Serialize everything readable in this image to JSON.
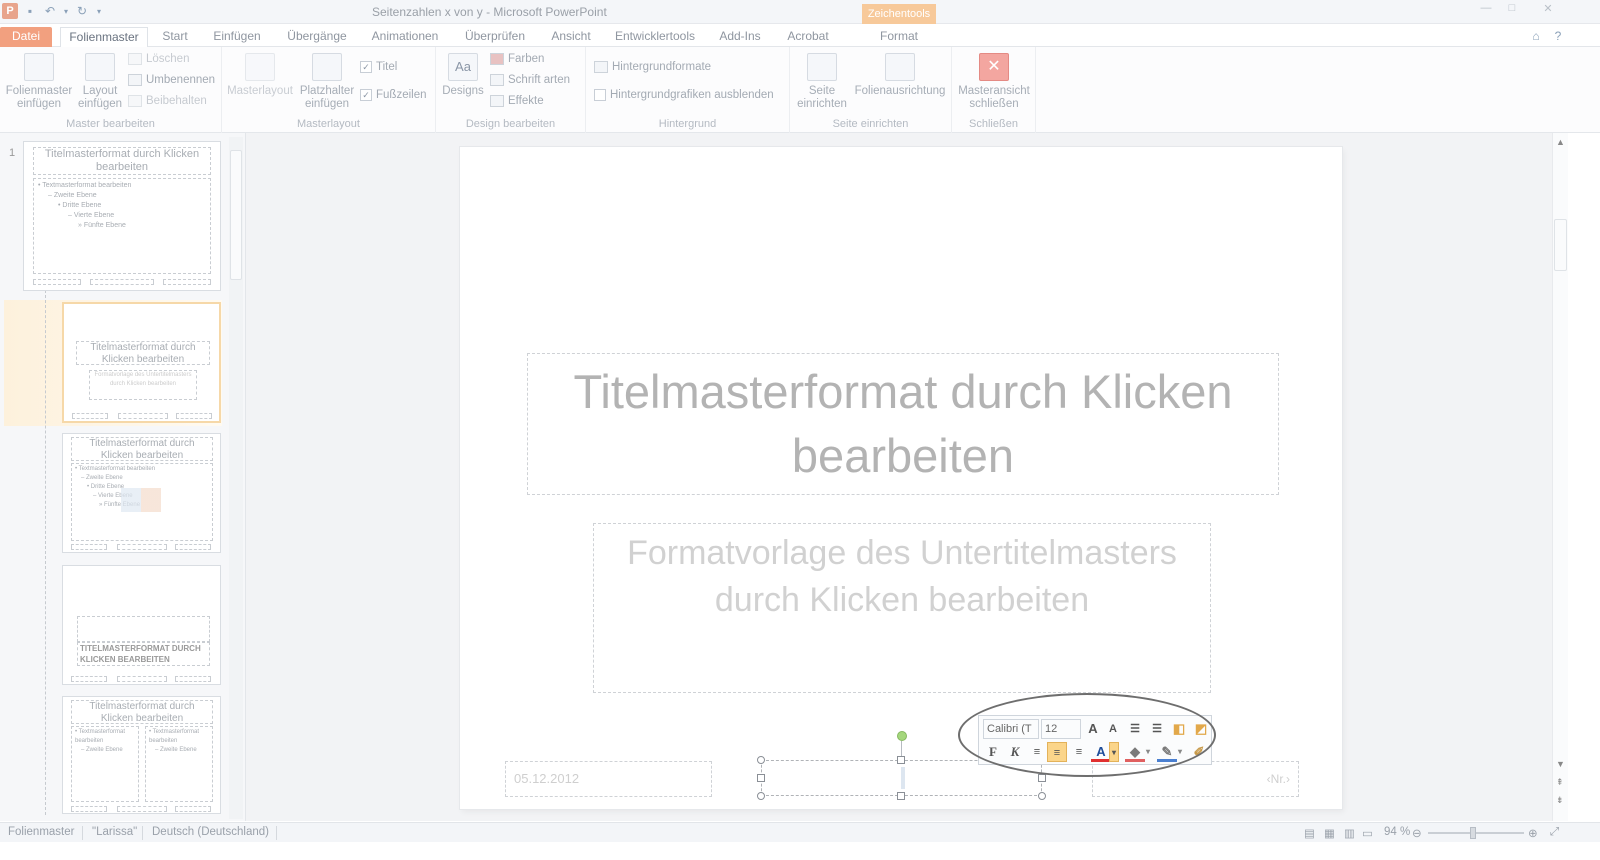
{
  "window": {
    "title": "Seitenzahlen x von y  -  Microsoft PowerPoint",
    "contextual_tab": "Zeichentools",
    "app_logo": "P"
  },
  "tabs": [
    "Datei",
    "Folienmaster",
    "Start",
    "Einfügen",
    "Übergänge",
    "Animationen",
    "Überprüfen",
    "Ansicht",
    "Entwicklertools",
    "Add-Ins",
    "Acrobat",
    "Format"
  ],
  "ribbon": {
    "master_bearbeiten": {
      "label": "Master bearbeiten",
      "folienmaster_einfuegen": [
        "Folienmaster",
        "einfügen"
      ],
      "layout_einfuegen": [
        "Layout",
        "einfügen"
      ],
      "loeschen": "Löschen",
      "umbenennen": "Umbenennen",
      "beibehalten": "Beibehalten"
    },
    "masterlayout": {
      "label": "Masterlayout",
      "masterlayout": "Masterlayout",
      "platzhalter_einfuegen": [
        "Platzhalter",
        "einfügen"
      ],
      "titel": "Titel",
      "fusszeilen": "Fußzeilen"
    },
    "design_bearbeiten": {
      "label": "Design bearbeiten",
      "designs": "Designs",
      "farben": "Farben",
      "schriftarten": "Schrift arten",
      "effekte": "Effekte"
    },
    "hintergrund": {
      "label": "Hintergrund",
      "hintergrundformate": "Hintergrundformate",
      "hintergrundgrafiken": "Hintergrundgrafiken ausblenden"
    },
    "seite_einrichten": {
      "label": "Seite einrichten",
      "seite_einrichten": [
        "Seite",
        "einrichten"
      ],
      "folienausrichtung": "Folienausrichtung"
    },
    "schliessen": {
      "label": "Schließen",
      "masteransicht_schliessen": [
        "Masteransicht",
        "schließen"
      ]
    }
  },
  "thumbnails": {
    "slide_number": "1",
    "t1": {
      "title": "Titelmasterformat durch Klicken bearbeiten",
      "body": [
        "• Textmasterformat bearbeiten",
        "– Zweite Ebene",
        "• Dritte Ebene",
        "– Vierte Ebene",
        "» Fünfte Ebene"
      ]
    },
    "t2": {
      "title": "Titelmasterformat durch Klicken bearbeiten",
      "subtitle": "Formatvorlage des Untertitelmasters durch Klicken bearbeiten"
    },
    "t3": {
      "title": "Titelmasterformat durch Klicken bearbeiten",
      "body": [
        "• Textmasterformat bearbeiten",
        "– Zweite Ebene",
        "• Dritte Ebene",
        "– Vierte Ebene",
        "» Fünfte Ebene"
      ]
    },
    "t4": {
      "title": "TITELMASTERFORMAT DURCH KLICKEN BEARBEITEN"
    },
    "t5": {
      "title": "Titelmasterformat durch Klicken bearbeiten",
      "left": [
        "• Textmasterformat bearbeiten",
        "– Zweite Ebene"
      ],
      "right": [
        "• Textmasterformat bearbeiten",
        "– Zweite Ebene"
      ]
    }
  },
  "slide": {
    "title": "Titelmasterformat durch Klicken bearbeiten",
    "subtitle": "Formatvorlage des Untertitelmasters durch Klicken bearbeiten",
    "date": "05.12.2012",
    "number": "‹Nr.›"
  },
  "minitoolbar": {
    "font": "Calibri (T",
    "size": "12",
    "bold": "F",
    "italic": "K",
    "font_color_glyph": "A"
  },
  "statusbar": {
    "view": "Folienmaster",
    "theme": "\"Larissa\"",
    "language": "Deutsch (Deutschland)",
    "zoom": "94 %"
  },
  "colors": {
    "datei_tab": "#f2a07f",
    "contextual_tab": "#f7c99a",
    "selection_highlight": "#fbd58a",
    "rotation_handle": "#a5d77d"
  }
}
